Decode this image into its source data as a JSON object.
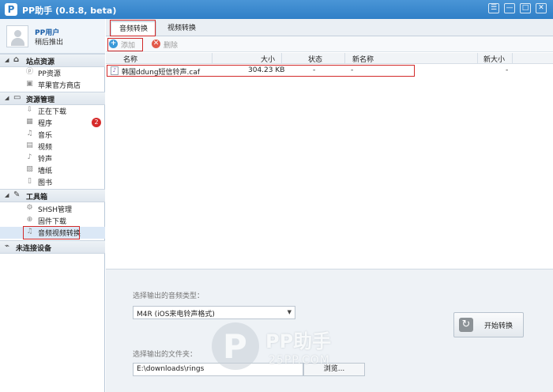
{
  "window": {
    "title": "PP助手 (0.8.8, beta)",
    "logo_letter": "P"
  },
  "window_controls": {
    "menu": "☰",
    "minimize": "—",
    "maximize": "□",
    "close": "✕"
  },
  "user": {
    "name": "PP用户",
    "action": "稍后推出"
  },
  "sidebar": {
    "sections": [
      {
        "label": "站点资源",
        "icon": "home-icon",
        "items": [
          {
            "label": "PP资源",
            "icon": "pp-resource-icon"
          },
          {
            "label": "苹果官方商店",
            "icon": "store-icon"
          }
        ]
      },
      {
        "label": "资源管理",
        "icon": "monitor-icon",
        "items": [
          {
            "label": "正在下载",
            "icon": "download-icon"
          },
          {
            "label": "程序",
            "icon": "app-icon",
            "badge": "2"
          },
          {
            "label": "音乐",
            "icon": "headphones-icon"
          },
          {
            "label": "视频",
            "icon": "video-icon"
          },
          {
            "label": "铃声",
            "icon": "ringtone-icon"
          },
          {
            "label": "墙纸",
            "icon": "wallpaper-icon"
          },
          {
            "label": "图书",
            "icon": "book-icon"
          }
        ]
      },
      {
        "label": "工具箱",
        "icon": "toolbox-icon",
        "items": [
          {
            "label": "SHSH管理",
            "icon": "shsh-icon"
          },
          {
            "label": "固件下载",
            "icon": "firmware-icon"
          },
          {
            "label": "音频视频转换",
            "icon": "convert-icon",
            "selected": true
          }
        ]
      }
    ],
    "device": {
      "label": "未连接设备",
      "icon": "disconnected-icon"
    }
  },
  "tabs": [
    {
      "label": "音频转换",
      "active": true
    },
    {
      "label": "视频转换",
      "active": false
    }
  ],
  "toolbar": {
    "add_label": "添加",
    "delete_label": "删除"
  },
  "table": {
    "columns": [
      "名称",
      "大小",
      "状态",
      "新名称",
      "新大小"
    ],
    "rows": [
      {
        "name": "韩国ddung短信铃声.caf",
        "size": "304.23 KB",
        "status": "-",
        "new_name": "-",
        "new_size": "-"
      }
    ]
  },
  "convert_panel": {
    "format_label": "选择输出的音频类型：",
    "format_value": "M4R (iOS来电铃声格式)",
    "folder_label": "选择输出的文件夹：",
    "folder_value": "E:\\downloads\\rings",
    "browse_label": "浏览...",
    "start_label": "开始转换"
  },
  "watermark": {
    "logo_text": "PP助手",
    "site": "25PP.COM"
  },
  "colors": {
    "titlebar": "#3a88cd",
    "highlight": "#d22a2a",
    "badge": "#d62b2b",
    "link": "#1a5ea8"
  }
}
